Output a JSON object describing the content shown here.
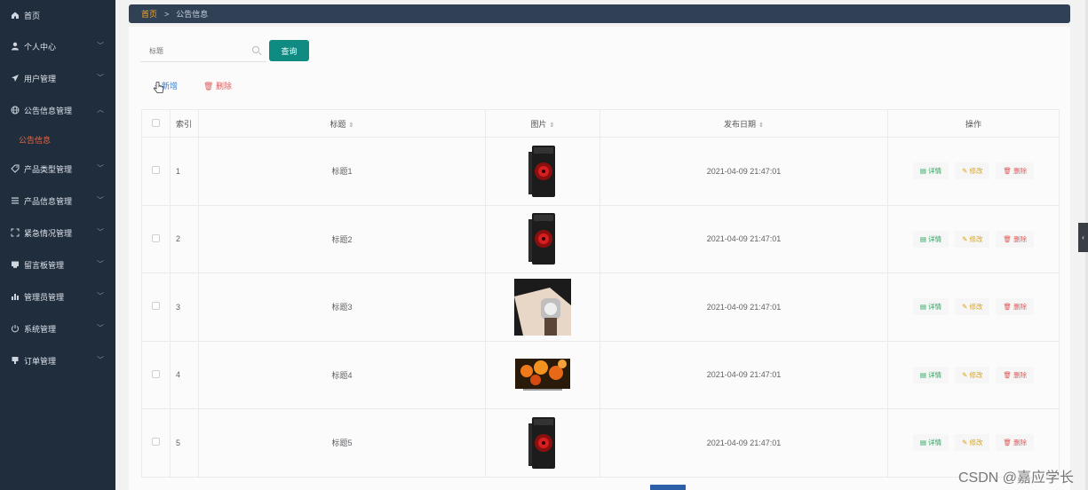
{
  "sidebar": {
    "items": [
      {
        "icon": "home-icon",
        "label": "首页",
        "chevron": false
      },
      {
        "icon": "user-icon",
        "label": "个人中心",
        "chevron": true
      },
      {
        "icon": "send-icon",
        "label": "用户管理",
        "chevron": true
      },
      {
        "icon": "globe-icon",
        "label": "公告信息管理",
        "chevron": true,
        "expanded": true
      },
      {
        "icon": "tag-icon",
        "label": "产品类型管理",
        "chevron": true
      },
      {
        "icon": "list-icon",
        "label": "产品信息管理",
        "chevron": true
      },
      {
        "icon": "fullscreen-icon",
        "label": "紧急情况管理",
        "chevron": true
      },
      {
        "icon": "message-icon",
        "label": "留言板管理",
        "chevron": true
      },
      {
        "icon": "bar-chart-icon",
        "label": "管理员管理",
        "chevron": true
      },
      {
        "icon": "power-icon",
        "label": "系统管理",
        "chevron": true
      },
      {
        "icon": "order-icon",
        "label": "订单管理",
        "chevron": true
      }
    ],
    "active_sub": "公告信息"
  },
  "breadcrumb": {
    "home": "首页",
    "separator": ">",
    "current": "公告信息"
  },
  "search": {
    "placeholder": "标题",
    "query_label": "查询"
  },
  "actions": {
    "add_label": "新增",
    "delete_label": "删除"
  },
  "table": {
    "headers": {
      "index": "索引",
      "title": "标题",
      "image": "图片",
      "date": "发布日期",
      "ops": "操作"
    },
    "rows": [
      {
        "index": "1",
        "title": "标题1",
        "image": "pc-case",
        "date": "2021-04-09 21:47:01"
      },
      {
        "index": "2",
        "title": "标题2",
        "image": "pc-case",
        "date": "2021-04-09 21:47:01"
      },
      {
        "index": "3",
        "title": "标题3",
        "image": "wristwatch",
        "date": "2021-04-09 21:47:01"
      },
      {
        "index": "4",
        "title": "标题4",
        "image": "tv-flowers",
        "date": "2021-04-09 21:47:01"
      },
      {
        "index": "5",
        "title": "标题5",
        "image": "pc-case",
        "date": "2021-04-09 21:47:01"
      }
    ],
    "op_labels": {
      "detail": "详情",
      "edit": "修改",
      "delete": "删除"
    }
  },
  "watermark": "CSDN @嘉应学长",
  "colors": {
    "sidebar": "#1f2d3d",
    "breadcrumb": "#304156",
    "accent": "#0f8b82",
    "active_sub": "#e1694a"
  }
}
